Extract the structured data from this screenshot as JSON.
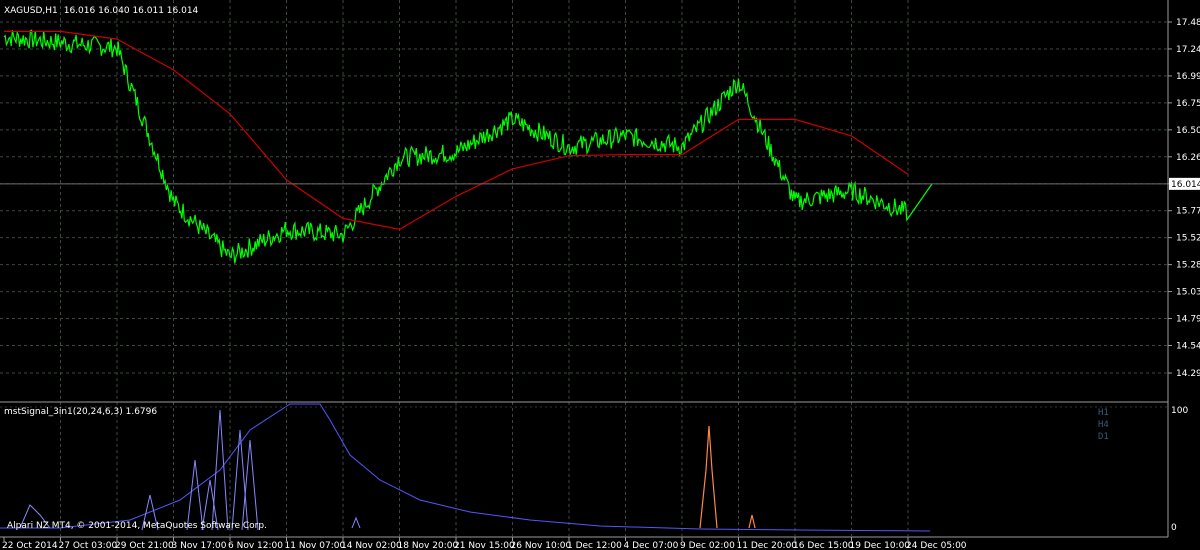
{
  "header": {
    "symbol": "XAGUSD,H1",
    "ohlc": "16.016 16.040 16.011 16.014"
  },
  "price_axis": {
    "ticks": [
      "17.485",
      "17.240",
      "16.995",
      "16.750",
      "16.505",
      "16.260",
      "16.015",
      "15.770",
      "15.525",
      "15.280",
      "15.035",
      "14.790",
      "14.545",
      "14.295"
    ],
    "current_price": "16.014"
  },
  "indicator": {
    "title": "mstSignal_3in1(20,24,6,3) 1.6796",
    "axis_top": "100",
    "axis_bottom": "0",
    "timeframes": [
      "H1",
      "H4",
      "D1"
    ],
    "copyright": "Alpari NZ MT4, © 2001-2014, MetaQuotes Software Corp."
  },
  "time_axis": {
    "labels": [
      "22 Oct 2014",
      "27 Oct 03:00",
      "29 Oct 21:00",
      "3 Nov 17:00",
      "6 Nov 12:00",
      "11 Nov 07:00",
      "14 Nov 02:00",
      "18 Nov 20:00",
      "21 Nov 15:00",
      "26 Nov 10:00",
      "1 Dec 12:00",
      "4 Dec 07:00",
      "9 Dec 02:00",
      "11 Dec 20:00",
      "16 Dec 15:00",
      "19 Dec 10:00",
      "24 Dec 05:00"
    ]
  },
  "colors": {
    "background": "#000000",
    "grid": "#3a4a3a",
    "price_line": "#00ff00",
    "moving_average": "#cc0000",
    "indicator_blue": "#5555ff",
    "indicator_orange": "#ff8844",
    "axis_text": "#ffffff"
  },
  "chart_data": {
    "type": "line",
    "price_series": {
      "x": [
        "22 Oct 2014",
        "27 Oct 03:00",
        "29 Oct 21:00",
        "3 Nov 17:00",
        "6 Nov 12:00",
        "11 Nov 07:00",
        "14 Nov 02:00",
        "18 Nov 20:00",
        "21 Nov 15:00",
        "26 Nov 10:00",
        "1 Dec 12:00",
        "4 Dec 07:00",
        "9 Dec 02:00",
        "11 Dec 20:00",
        "16 Dec 15:00",
        "19 Dec 10:00",
        "24 Dec 05:00"
      ],
      "close": [
        17.35,
        17.3,
        17.25,
        15.85,
        15.35,
        15.6,
        15.55,
        16.25,
        16.3,
        16.6,
        16.35,
        16.45,
        16.35,
        16.95,
        15.85,
        15.95,
        15.75
      ],
      "ma": [
        17.4,
        17.4,
        17.33,
        17.05,
        16.65,
        16.05,
        15.7,
        15.6,
        15.9,
        16.15,
        16.27,
        16.28,
        16.28,
        16.6,
        16.6,
        16.45,
        16.1
      ]
    },
    "ylim": [
      14.295,
      17.485
    ],
    "grid": true
  }
}
